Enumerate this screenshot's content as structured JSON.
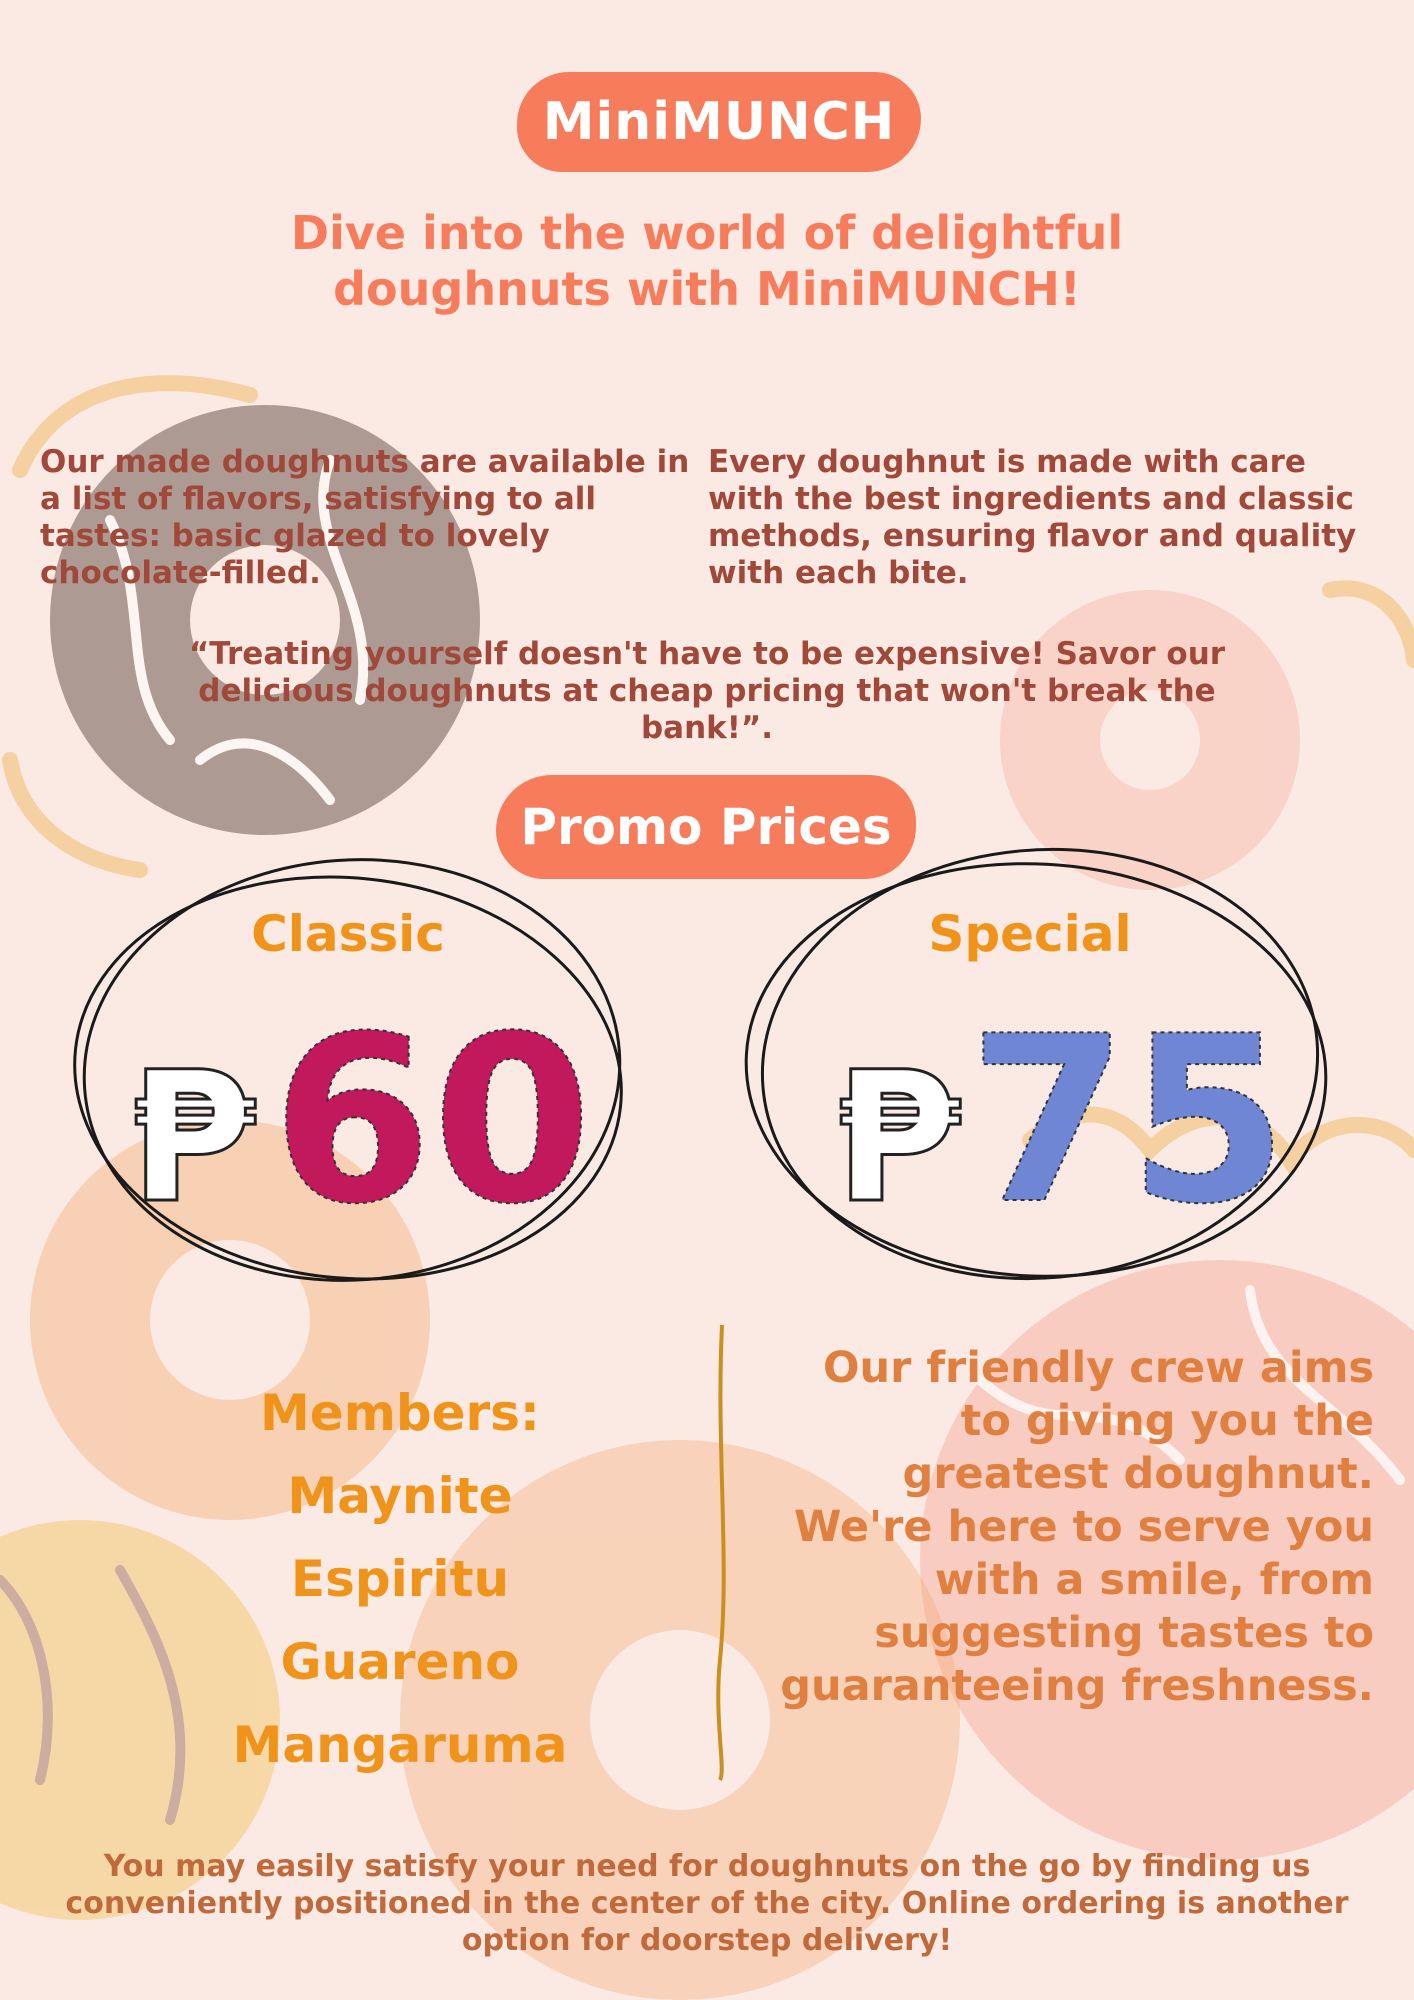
{
  "brand": {
    "name": "MiniMUNCH"
  },
  "headline": "Dive into the world of delightful doughnuts with MiniMUNCH!",
  "intro": {
    "left": "Our made doughnuts are available in a list of flavors, satisfying to all tastes: basic glazed to lovely chocolate-filled.",
    "right": "Every doughnut is made with care with the best ingredients and classic methods, ensuring flavor and quality with each bite."
  },
  "quote": "“Treating yourself doesn't have to be expensive! Savor our delicious doughnuts at cheap pricing that won't break the bank!”.",
  "promo": {
    "title": "Promo Prices",
    "currency_symbol": "₱",
    "items": [
      {
        "label": "Classic",
        "price": "60",
        "fill": "#c2195c"
      },
      {
        "label": "Special",
        "price": "75",
        "fill": "#6f86d4"
      }
    ]
  },
  "members": {
    "heading": "Members:",
    "names": [
      "Maynite",
      "Espiritu",
      "Guareno",
      "Mangaruma"
    ]
  },
  "crew_text": "Our friendly crew aims to giving you the greatest doughnut. We're here to serve you with a smile, from suggesting tastes to guaranteeing freshness.",
  "footer": "You may easily satisfy your need for doughnuts on the go by finding us conveniently positioned in the center of the city. Online ordering is another option for doorstep delivery!",
  "colors": {
    "background": "#fbeae4",
    "accent": "#f77c5c",
    "body_text": "#a0483a",
    "label_orange": "#f0931a",
    "divider": "#c9901f"
  }
}
